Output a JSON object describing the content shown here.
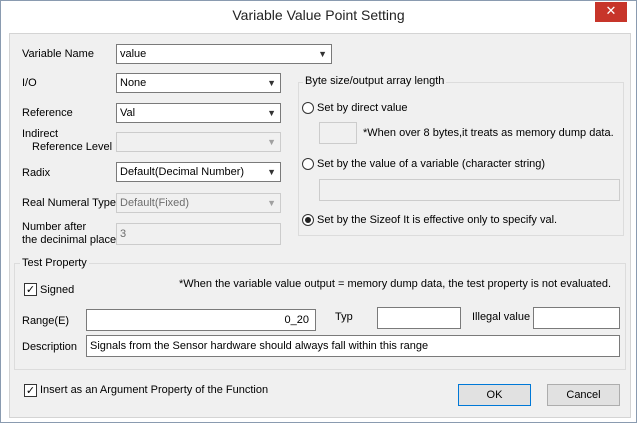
{
  "window": {
    "title": "Variable Value Point Setting",
    "close_glyph": "✕"
  },
  "fields": {
    "variable_name": {
      "label": "Variable Name",
      "value": "value"
    },
    "io": {
      "label": "I/O",
      "value": "None"
    },
    "reference": {
      "label": "Reference",
      "value": "Val"
    },
    "indirect_reference_level": {
      "label_line1": "Indirect",
      "label_line2": "Reference Level",
      "value": ""
    },
    "radix": {
      "label": "Radix",
      "value": "Default(Decimal Number)"
    },
    "real_numeral_type": {
      "label": "Real Numeral Type",
      "value": "Default(Fixed)"
    },
    "decimal_places": {
      "label_line1": "Number after",
      "label_line2": "the decinimal place",
      "value": "3"
    }
  },
  "byte_size": {
    "group_title": "Byte size/output array length",
    "option_direct": "Set by direct value",
    "direct_value": "",
    "direct_note": "*When over 8 bytes,it treats as memory dump data.",
    "option_variable": "Set by the value of a variable (character string)",
    "variable_value": "",
    "option_sizeof": "Set by the Sizeof   It is effective only to specify val.",
    "selected": "sizeof"
  },
  "test_property": {
    "group_title": "Test Property",
    "signed_label": "Signed",
    "signed_checked": true,
    "note": "*When the variable value output = memory dump data, the test property is not evaluated.",
    "range_label": "Range(E)",
    "range_value": "0_20",
    "typ_label": "Typ",
    "typ_value": "",
    "illegal_label": "Illegal value",
    "illegal_value": "",
    "description_label": "Description",
    "description_value": "Signals from the Sensor hardware should always fall within this range"
  },
  "footer": {
    "insert_label": "Insert as an Argument Property of the Function",
    "insert_checked": true,
    "ok_label": "OK",
    "cancel_label": "Cancel"
  },
  "icons": {
    "dropdown": "chevron-down-icon",
    "check": "checkmark-icon",
    "close": "close-icon"
  },
  "colors": {
    "close_button": "#c7352a",
    "default_button_border": "#0078d7",
    "dialog_background": "#f0f0f0"
  }
}
